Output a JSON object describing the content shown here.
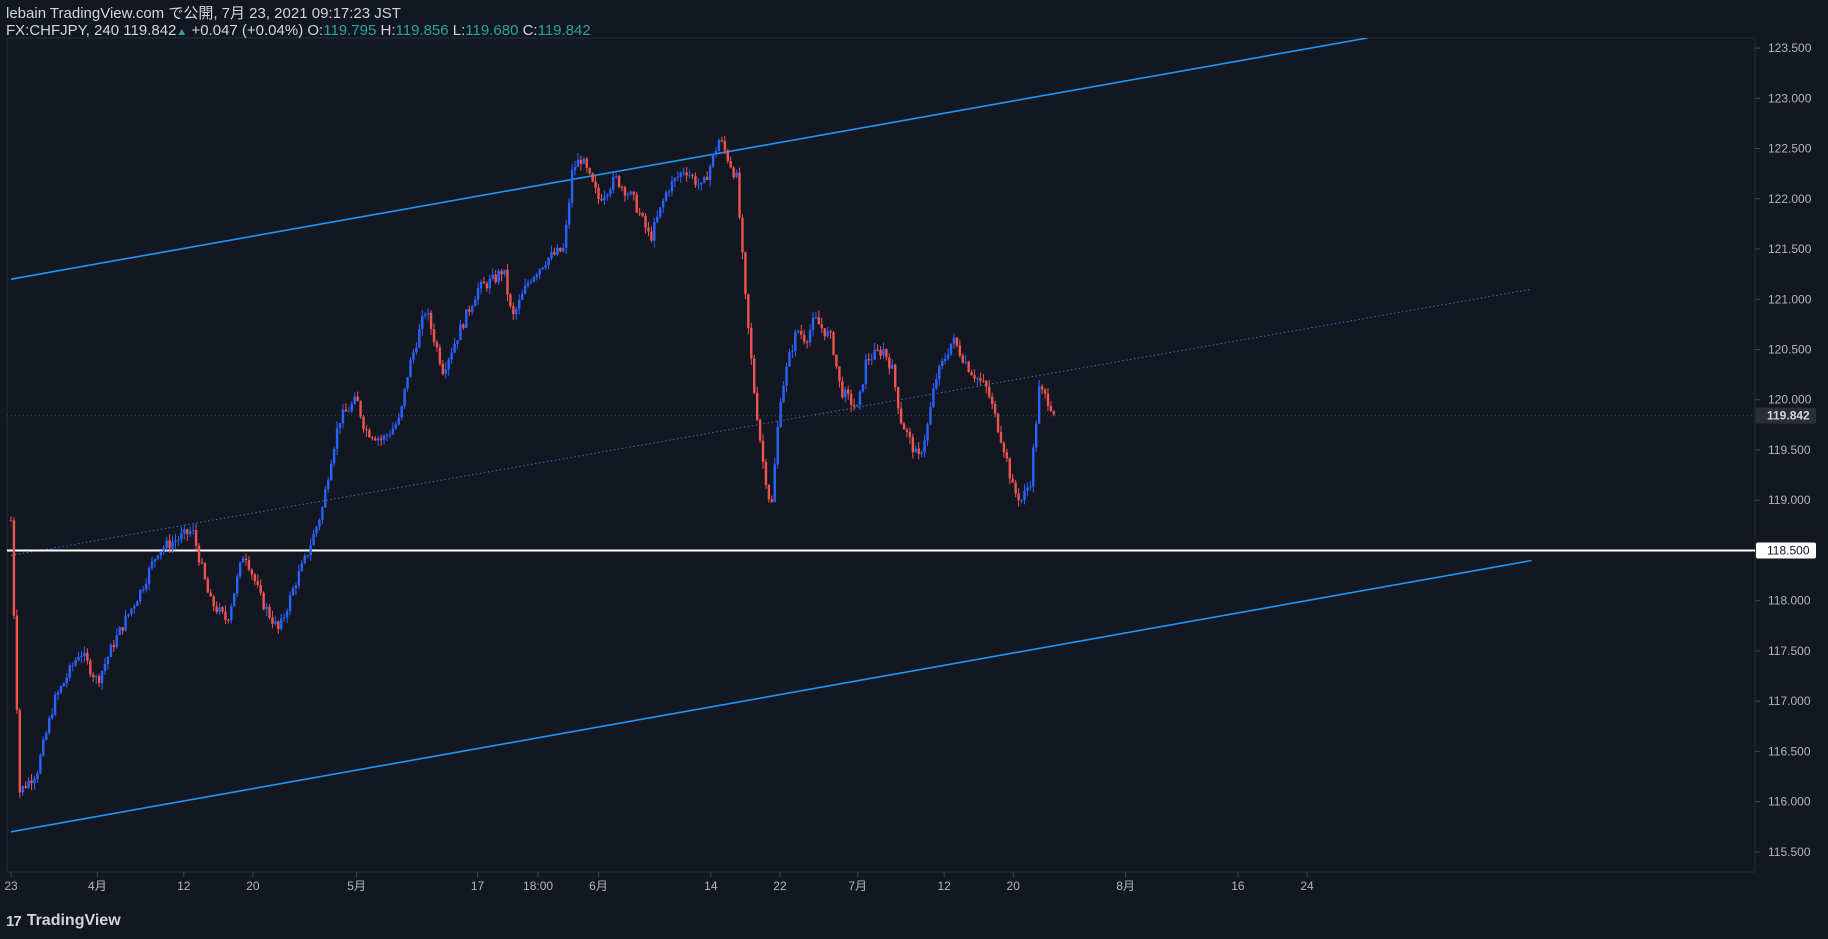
{
  "header": {
    "line1": "lebain TradingView.com で公開, 7月 23, 2021 09:17:23 JST",
    "symbol": "FX:CHFJPY, 240",
    "last": "119.842",
    "change_arrow": "▲",
    "change": "+0.047 (+0.04%)",
    "o_label": "O:",
    "o_value": "119.795",
    "h_label": "H:",
    "h_value": "119.856",
    "l_label": "L:",
    "l_value": "119.680",
    "c_label": "C:",
    "c_value": "119.842"
  },
  "footer": {
    "brand": "TradingView",
    "logo_glyph": "17"
  },
  "colors": {
    "background": "#131722",
    "up_candle": "#2962ff",
    "down_candle": "#ef5350",
    "channel_line": "#2196f3",
    "horizontal_level": "#ffffff",
    "axis_text": "#b2b5be",
    "change_up": "#26a69a"
  },
  "chart_data": {
    "type": "candlestick",
    "symbol": "FX:CHFJPY",
    "timeframe": "240",
    "ylim": [
      115.3,
      123.6
    ],
    "y_ticks": [
      "123.500",
      "123.000",
      "122.500",
      "122.000",
      "121.500",
      "121.000",
      "120.500",
      "120.000",
      "119.500",
      "119.000",
      "118.500",
      "118.000",
      "117.500",
      "117.000",
      "116.500",
      "116.000",
      "115.500"
    ],
    "x_ticks": [
      {
        "label": "23",
        "i": 0
      },
      {
        "label": "4月",
        "i": 10
      },
      {
        "label": "12",
        "i": 20
      },
      {
        "label": "20",
        "i": 28
      },
      {
        "label": "5月",
        "i": 40
      },
      {
        "label": "17",
        "i": 54
      },
      {
        "label": "18:00",
        "i": 61
      },
      {
        "label": "6月",
        "i": 68
      },
      {
        "label": "14",
        "i": 81
      },
      {
        "label": "22",
        "i": 89
      },
      {
        "label": "7月",
        "i": 98
      },
      {
        "label": "12",
        "i": 108
      },
      {
        "label": "20",
        "i": 116
      },
      {
        "label": "8月",
        "i": 129
      },
      {
        "label": "16",
        "i": 142
      },
      {
        "label": "24",
        "i": 150
      }
    ],
    "price_path": [
      [
        0,
        118.8
      ],
      [
        1,
        116.1
      ],
      [
        3,
        116.3
      ],
      [
        5,
        117.0
      ],
      [
        8,
        117.5
      ],
      [
        10,
        117.2
      ],
      [
        12,
        117.6
      ],
      [
        15,
        118.1
      ],
      [
        17,
        118.5
      ],
      [
        19,
        118.6
      ],
      [
        21,
        118.7
      ],
      [
        23,
        118.0
      ],
      [
        25,
        117.8
      ],
      [
        27,
        118.5
      ],
      [
        29,
        118.0
      ],
      [
        31,
        117.7
      ],
      [
        33,
        118.2
      ],
      [
        34,
        118.4
      ],
      [
        36,
        118.9
      ],
      [
        37,
        119.4
      ],
      [
        38,
        119.8
      ],
      [
        40,
        120.0
      ],
      [
        41,
        119.7
      ],
      [
        43,
        119.6
      ],
      [
        45,
        119.8
      ],
      [
        46,
        120.3
      ],
      [
        48,
        120.9
      ],
      [
        50,
        120.3
      ],
      [
        52,
        120.7
      ],
      [
        54,
        121.1
      ],
      [
        56,
        121.2
      ],
      [
        57,
        121.3
      ],
      [
        58,
        120.8
      ],
      [
        60,
        121.2
      ],
      [
        62,
        121.4
      ],
      [
        64,
        121.5
      ],
      [
        65,
        122.3
      ],
      [
        66,
        122.4
      ],
      [
        68,
        122.0
      ],
      [
        70,
        122.2
      ],
      [
        72,
        122.0
      ],
      [
        74,
        121.6
      ],
      [
        76,
        122.1
      ],
      [
        78,
        122.3
      ],
      [
        80,
        122.1
      ],
      [
        82,
        122.6
      ],
      [
        84,
        122.2
      ],
      [
        85,
        121.0
      ],
      [
        86,
        120.1
      ],
      [
        87,
        119.4
      ],
      [
        88,
        118.9
      ],
      [
        89,
        120.0
      ],
      [
        90,
        120.4
      ],
      [
        91,
        120.7
      ],
      [
        92,
        120.6
      ],
      [
        93,
        120.8
      ],
      [
        95,
        120.6
      ],
      [
        96,
        120.1
      ],
      [
        98,
        119.9
      ],
      [
        99,
        120.4
      ],
      [
        101,
        120.5
      ],
      [
        102,
        120.3
      ],
      [
        103,
        119.8
      ],
      [
        105,
        119.4
      ],
      [
        106,
        119.7
      ],
      [
        107,
        120.2
      ],
      [
        109,
        120.6
      ],
      [
        111,
        120.3
      ],
      [
        113,
        120.1
      ],
      [
        114,
        119.8
      ],
      [
        115,
        119.5
      ],
      [
        116,
        119.1
      ],
      [
        117,
        119.0
      ],
      [
        118,
        119.2
      ],
      [
        119,
        120.1
      ],
      [
        120,
        120.0
      ],
      [
        121,
        119.84
      ]
    ],
    "horizontal_line": 118.5,
    "last_price": 119.842,
    "channel": {
      "upper": [
        [
          0,
          121.2
        ],
        [
          157,
          123.6
        ]
      ],
      "middle": [
        [
          0,
          118.45
        ],
        [
          176,
          121.1
        ]
      ],
      "lower": [
        [
          0,
          115.7
        ],
        [
          176,
          118.4
        ]
      ]
    }
  }
}
